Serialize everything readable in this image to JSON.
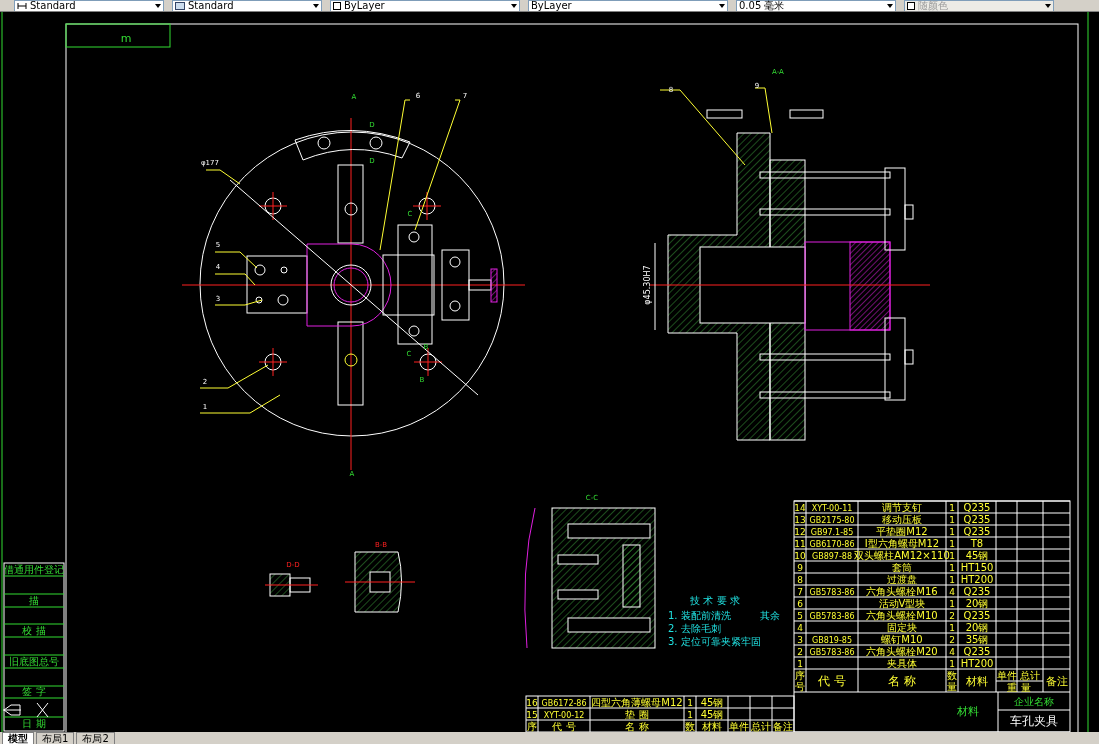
{
  "toolbar": {
    "dropdowns": [
      {
        "kind": "dimstyle",
        "value": "Standard",
        "disabled": false
      },
      {
        "kind": "tablestyle",
        "value": "Standard",
        "disabled": false
      },
      {
        "kind": "layer",
        "value": "ByLayer",
        "disabled": false
      },
      {
        "kind": "linetype",
        "value": "ByLayer",
        "disabled": false
      },
      {
        "kind": "lineweight",
        "value": "0.05 毫米",
        "disabled": false
      },
      {
        "kind": "color",
        "value": "随颜色",
        "disabled": true
      }
    ]
  },
  "drawing": {
    "corner_tag": "m",
    "plan_view_labels": [
      "A",
      "A",
      "D",
      "D",
      "φ177",
      "6",
      "7",
      "C",
      "C",
      "B",
      "B",
      "5",
      "4",
      "3",
      "2",
      "1"
    ],
    "section_view": {
      "title": "A-A",
      "labels": [
        "8",
        "9"
      ],
      "dimension": "φ45.30H7"
    },
    "detail_views": [
      {
        "title": "C-C"
      },
      {
        "title": "B-B"
      },
      {
        "title": "D-D"
      }
    ],
    "technical_notes": {
      "title": "技 术 要 求",
      "lines": [
        "1. 装配前清洗",
        "2. 去除毛刺",
        "3. 定位可靠夹紧牢固"
      ],
      "roughness": "其余"
    },
    "left_column": [
      "借通用件登记",
      "描",
      "校 描",
      "旧底图总号",
      "签 字",
      "日 期"
    ],
    "parts_list": {
      "rows": [
        {
          "no": "14",
          "code": "XYT-00-11",
          "name": "调节支钉",
          "qty": "1",
          "material": "Q235"
        },
        {
          "no": "13",
          "code": "GB2175-80",
          "name": "移动压板",
          "qty": "1",
          "material": "Q235"
        },
        {
          "no": "12",
          "code": "GB97.1-85",
          "name": "平垫圈M12",
          "qty": "1",
          "material": "Q235"
        },
        {
          "no": "11",
          "code": "GB6170-86",
          "name": "I型六角螺母M12",
          "qty": "1",
          "material": "T8"
        },
        {
          "no": "10",
          "code": "GB897-88",
          "name": "双头螺柱AM12×110",
          "qty": "1",
          "material": "45钢"
        },
        {
          "no": "9",
          "code": "",
          "name": "套筒",
          "qty": "1",
          "material": "HT150"
        },
        {
          "no": "8",
          "code": "",
          "name": "过渡盘",
          "qty": "1",
          "material": "HT200"
        },
        {
          "no": "7",
          "code": "GB5783-86",
          "name": "六角头螺栓M16",
          "qty": "4",
          "material": "Q235"
        },
        {
          "no": "6",
          "code": "",
          "name": "活动V型块",
          "qty": "1",
          "material": "20钢"
        },
        {
          "no": "5",
          "code": "GB5783-86",
          "name": "六角头螺栓M10",
          "qty": "2",
          "material": "Q235"
        },
        {
          "no": "4",
          "code": "",
          "name": "固定块",
          "qty": "1",
          "material": "20钢"
        },
        {
          "no": "3",
          "code": "GB819-85",
          "name": "螺钉M10",
          "qty": "2",
          "material": "35钢"
        },
        {
          "no": "2",
          "code": "GB5783-86",
          "name": "六角头螺栓M20",
          "qty": "4",
          "material": "Q235"
        },
        {
          "no": "1",
          "code": "",
          "name": "夹具体",
          "qty": "1",
          "material": "HT200"
        }
      ],
      "header": {
        "no": "序号",
        "code": "代 号",
        "name": "名 称",
        "qty": "数量",
        "material": "材料",
        "unit": "单件",
        "total": "总计",
        "weight": "重 量",
        "remark": "备注"
      }
    },
    "extra_parts": {
      "rows": [
        {
          "no": "16",
          "code": "GB6172-86",
          "name": "四型六角薄螺母M12",
          "qty": "1",
          "material": "45钢"
        },
        {
          "no": "15",
          "code": "XYT-00-12",
          "name": "垫 圈",
          "qty": "1",
          "material": "45钢"
        }
      ],
      "header": {
        "no": "序",
        "code": "代 号",
        "name": "名 称",
        "qty": "数",
        "material": "材料",
        "unit": "单件",
        "total": "总计",
        "remark": "备注"
      }
    },
    "title_block": {
      "material": "材料",
      "company": "企业名称",
      "drawing_name": "车孔夹具"
    }
  },
  "layout_tabs": [
    {
      "label": "模型",
      "selected": true
    },
    {
      "label": "布局1",
      "selected": false
    },
    {
      "label": "布局2",
      "selected": false
    }
  ]
}
